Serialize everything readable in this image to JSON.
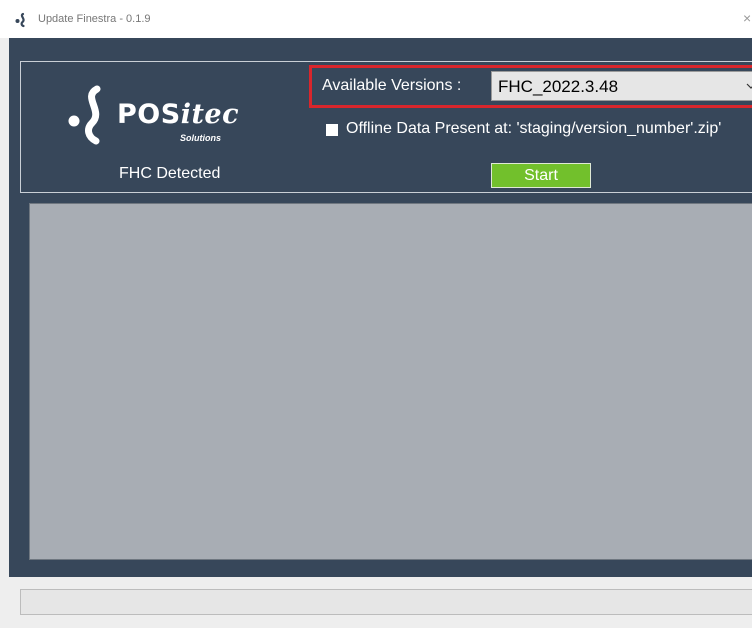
{
  "window": {
    "title": "Update Finestra - 0.1.9",
    "close_glyph": "×",
    "app_icon": "positec-swirl-icon"
  },
  "logo": {
    "name_main": "POS",
    "name_italic": "itec",
    "tagline": "Solutions"
  },
  "status": {
    "detected": "FHC Detected"
  },
  "versions": {
    "label": "Available Versions :",
    "selected": "FHC_2022.3.48",
    "highlight_color": "#d9262c"
  },
  "offline": {
    "label": "Offline Data Present at: 'staging/version_number'.zip'",
    "checked": false
  },
  "start": {
    "label": "Start",
    "color": "#72c02c"
  },
  "progress": {
    "value": 0
  },
  "colors": {
    "panel": "#37475a",
    "log_area": "#a8adb4"
  }
}
